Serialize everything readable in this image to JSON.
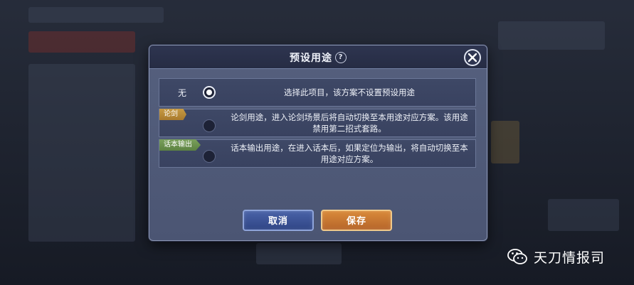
{
  "dialog": {
    "title": "预设用途",
    "help_icon_text": "?",
    "options": [
      {
        "label": "无",
        "tag": "",
        "description": "选择此项目，该方案不设置预设用途",
        "selected": true
      },
      {
        "label": "",
        "tag": "论剑",
        "description": "论剑用途，进入论剑场景后将自动切换至本用途对应方案。该用途禁用第二招式套路。",
        "selected": false
      },
      {
        "label": "",
        "tag": "话本输出",
        "description": "话本输出用途，在进入话本后，如果定位为输出，将自动切换至本用途对应方案。",
        "selected": false
      }
    ],
    "cancel_label": "取消",
    "save_label": "保存"
  },
  "watermark": {
    "text": "天刀情报司",
    "icon": "wechat-icon"
  },
  "colors": {
    "tag_gold": "#c79a44",
    "tag_green": "#7aa05c",
    "cancel_blue": "#3b529a",
    "save_orange": "#c8763a"
  }
}
